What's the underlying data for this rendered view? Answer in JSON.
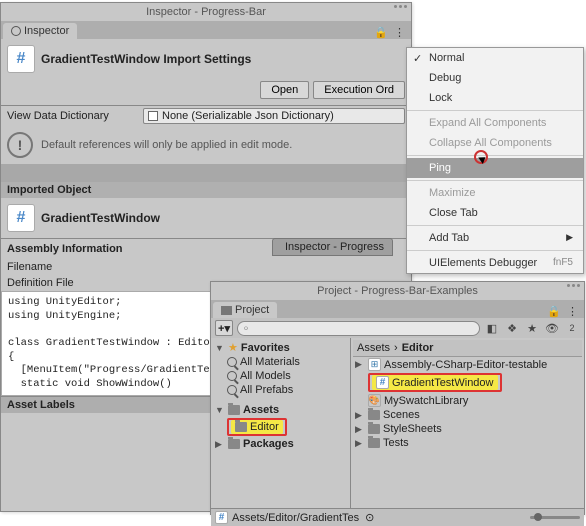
{
  "inspector": {
    "window_title": "Inspector - Progress-Bar",
    "tab": "Inspector",
    "asset_title": "GradientTestWindow Import Settings",
    "open_btn": "Open",
    "exec_order_btn": "Execution Ord",
    "view_dict_label": "View Data Dictionary",
    "view_dict_value": "None (Serializable Json Dictionary)",
    "warn_text": "Default references will only be applied in edit mode.",
    "imported_header": "Imported Object",
    "imported_name": "GradientTestWindow",
    "assembly_header": "Assembly Information",
    "filename_label": "Filename",
    "definition_label": "Definition File",
    "asset_labels": "Asset Labels",
    "code": "using UnityEditor;\nusing UnityEngine;\n\nclass GradientTestWindow : EditorW\n{\n  [MenuItem(\"Progress/GradientTe\n  static void ShowWindow()",
    "sub_tab": "Inspector - Progress"
  },
  "menu": {
    "normal": "Normal",
    "debug": "Debug",
    "lock": "Lock",
    "expand": "Expand All Components",
    "collapse": "Collapse All Components",
    "ping": "Ping",
    "maximize": "Maximize",
    "close": "Close Tab",
    "add": "Add Tab",
    "uidbg": "UIElements Debugger",
    "uidbg_key": "fnF5"
  },
  "project": {
    "window_title": "Project - Progress-Bar-Examples",
    "tab": "Project",
    "favorites": "Favorites",
    "all_mat": "All Materials",
    "all_mod": "All Models",
    "all_pre": "All Prefabs",
    "assets": "Assets",
    "editor": "Editor",
    "packages": "Packages",
    "breadcrumb_root": "Assets",
    "breadcrumb_leaf": "Editor",
    "items": {
      "asm": "Assembly-CSharp-Editor-testable",
      "grad": "GradientTestWindow",
      "swatch": "MySwatchLibrary",
      "scenes": "Scenes",
      "styles": "StyleSheets",
      "tests": "Tests"
    },
    "status_path": "Assets/Editor/GradientTes",
    "search_placeholder": "৹"
  }
}
